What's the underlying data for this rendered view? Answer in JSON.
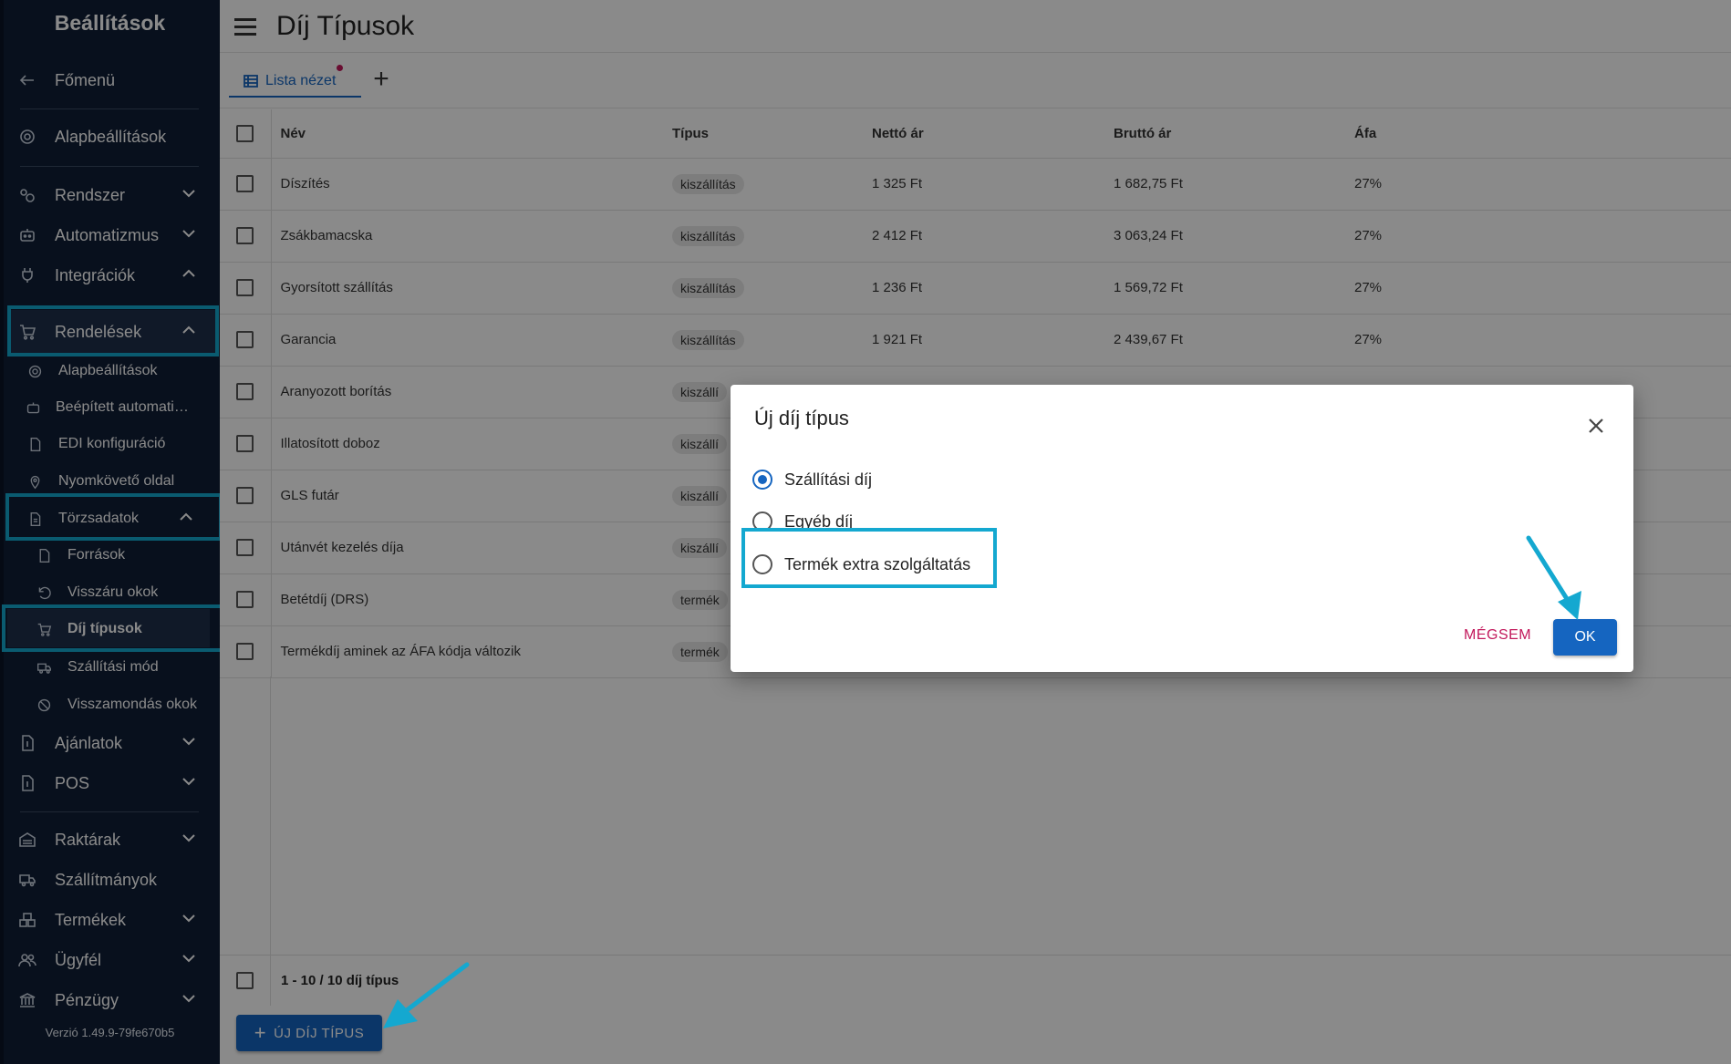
{
  "sidebar": {
    "title": "Beállítások",
    "main_menu": "Főmenü",
    "basic_settings": "Alapbeállítások",
    "groups": [
      {
        "label": "Rendszer"
      },
      {
        "label": "Automatizmus"
      },
      {
        "label": "Integrációk"
      },
      {
        "label": "Rendelések"
      }
    ],
    "orders_sub": [
      {
        "label": "Alapbeállítások"
      },
      {
        "label": "Beépített automatizmusok"
      },
      {
        "label": "EDI konfiguráció"
      },
      {
        "label": "Nyomkövető oldal"
      }
    ],
    "master_data": "Törzsadatok",
    "master_sub": [
      {
        "label": "Források"
      },
      {
        "label": "Visszáru okok"
      },
      {
        "label": "Díj típusok"
      },
      {
        "label": "Szállítási mód"
      },
      {
        "label": "Visszamondás okok"
      }
    ],
    "groups2": [
      {
        "label": "Ajánlatok"
      },
      {
        "label": "POS"
      },
      {
        "label": "Raktárak"
      },
      {
        "label": "Szállítmányok"
      },
      {
        "label": "Termékek"
      },
      {
        "label": "Ügyfél"
      },
      {
        "label": "Pénzügy"
      }
    ],
    "version": "Verzió 1.49.9-79fe670b5"
  },
  "header": {
    "title": "Díj Típusok",
    "tab_label": "Lista nézet"
  },
  "table": {
    "columns": [
      "Név",
      "Típus",
      "Nettó ár",
      "Bruttó ár",
      "Áfa"
    ],
    "rows": [
      {
        "name": "Díszítés",
        "type": "kiszállítás",
        "net": "1 325 Ft",
        "gross": "1 682,75 Ft",
        "vat": "27%"
      },
      {
        "name": "Zsákbamacska",
        "type": "kiszállítás",
        "net": "2 412 Ft",
        "gross": "3 063,24 Ft",
        "vat": "27%"
      },
      {
        "name": "Gyorsított szállítás",
        "type": "kiszállítás",
        "net": "1 236 Ft",
        "gross": "1 569,72 Ft",
        "vat": "27%"
      },
      {
        "name": "Garancia",
        "type": "kiszállítás",
        "net": "1 921 Ft",
        "gross": "2 439,67 Ft",
        "vat": "27%"
      },
      {
        "name": "Aranyozott borítás",
        "type": "kiszállí",
        "net": "",
        "gross": "",
        "vat": ""
      },
      {
        "name": "Illatosított doboz",
        "type": "kiszállí",
        "net": "",
        "gross": "",
        "vat": ""
      },
      {
        "name": "GLS futár",
        "type": "kiszállí",
        "net": "",
        "gross": "",
        "vat": ""
      },
      {
        "name": "Utánvét kezelés díja",
        "type": "kiszállí",
        "net": "",
        "gross": "",
        "vat": ""
      },
      {
        "name": "Betétdíj (DRS)",
        "type": "termék",
        "net": "",
        "gross": "",
        "vat": ""
      },
      {
        "name": "Termékdíj aminek az ÁFA kódja változik",
        "type": "termék",
        "net": "",
        "gross": "",
        "vat": ""
      }
    ],
    "footer_count": "1 - 10 / 10 díj típus"
  },
  "new_button": "ÚJ DÍJ TÍPUS",
  "dialog": {
    "title": "Új díj típus",
    "options": [
      {
        "label": "Szállítási díj",
        "selected": true
      },
      {
        "label": "Egyéb díj",
        "selected": false
      },
      {
        "label": "Termék extra szolgáltatás",
        "selected": false
      }
    ],
    "cancel": "MÉGSEM",
    "ok": "OK"
  },
  "colors": {
    "sidebar_bg": "#0f1e36",
    "accent": "#1565c0",
    "highlight": "#14a8d0",
    "cancel": "#c2185b"
  }
}
